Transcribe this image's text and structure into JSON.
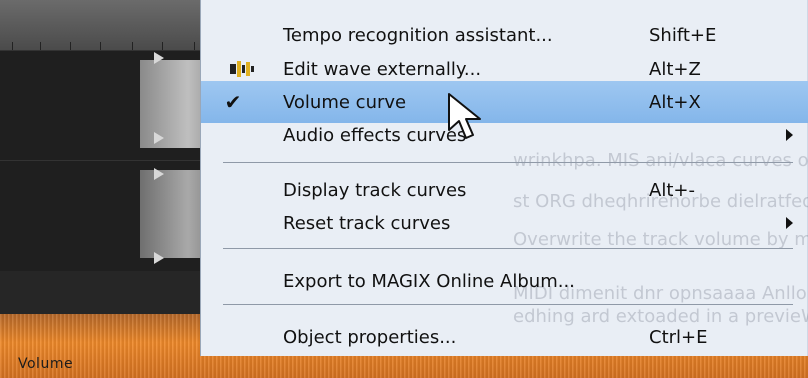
{
  "background": {
    "track_label": "Volume",
    "orange_color": "#f08a2a"
  },
  "menu": {
    "items": [
      {
        "label": "Tempo recognition assistant...",
        "shortcut": "Shift+E",
        "icon": "",
        "checked": false,
        "submenu": false
      },
      {
        "label": "Edit wave externally...",
        "shortcut": "Alt+Z",
        "icon": "waveform-edit-icon",
        "checked": false,
        "submenu": false
      },
      {
        "label": "Volume curve",
        "shortcut": "Alt+X",
        "icon": "",
        "checked": true,
        "submenu": false
      },
      {
        "label": "Audio effects curves",
        "shortcut": "",
        "icon": "",
        "checked": false,
        "submenu": true
      },
      {
        "label": "Display track curves",
        "shortcut": "Alt+-",
        "icon": "",
        "checked": false,
        "submenu": false
      },
      {
        "label": "Reset track curves",
        "shortcut": "",
        "icon": "",
        "checked": false,
        "submenu": true
      },
      {
        "label": "Export to MAGIX Online Album...",
        "shortcut": "",
        "icon": "",
        "checked": false,
        "submenu": false
      },
      {
        "label": "Object properties...",
        "shortcut": "Ctrl+E",
        "icon": "",
        "checked": false,
        "submenu": false
      }
    ],
    "ghost_text": [
      "wrinkhpa. MIS ani/vlaca curves on accolorouri",
      "st ORG dheqhrirehorbe dielratfed sechon oH dnlär ft",
      "Overwrite the track volume by means of the",
      "MIDI dimenit dnr opnsaaaa Anllon in pleaw (",
      "edhing ard extoaded in a previeW, and"
    ],
    "highlight_color": "#8dbdf0"
  }
}
